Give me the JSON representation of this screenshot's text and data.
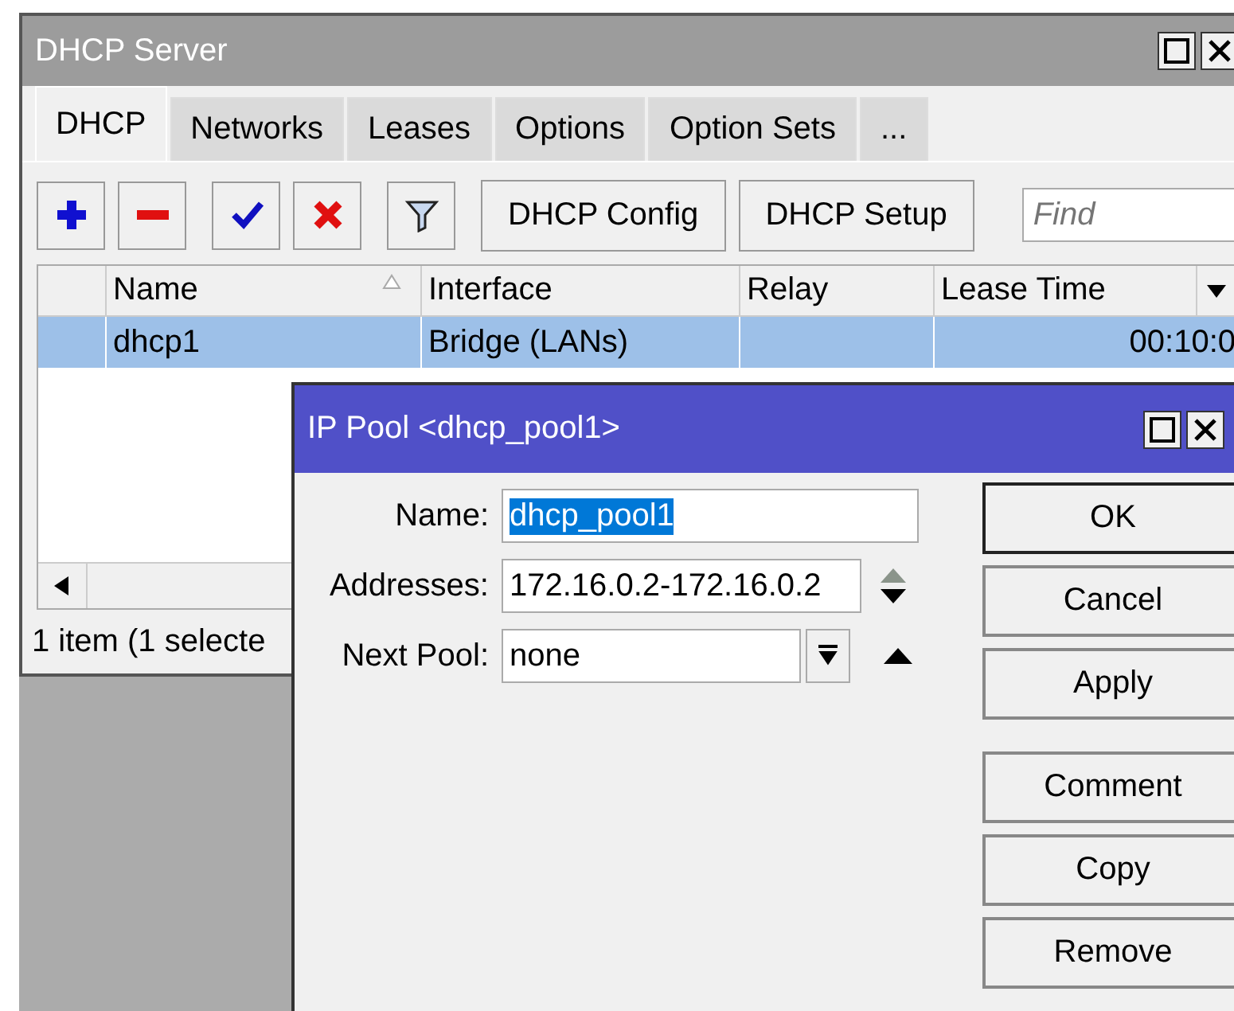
{
  "dhcp_window": {
    "title": "DHCP Server",
    "active": false,
    "tabs": [
      {
        "label": "DHCP",
        "selected": true
      },
      {
        "label": "Networks",
        "selected": false
      },
      {
        "label": "Leases",
        "selected": false
      },
      {
        "label": "Options",
        "selected": false
      },
      {
        "label": "Option Sets",
        "selected": false
      },
      {
        "label": "...",
        "selected": false
      }
    ],
    "toolbar_buttons": [
      "DHCP Config",
      "DHCP Setup"
    ],
    "find_placeholder": "Find",
    "table": {
      "columns": [
        "Name",
        "Interface",
        "Relay",
        "Lease Time"
      ],
      "rows": [
        {
          "name": "dhcp1",
          "interface": "Bridge (LANs)",
          "lease_time": "00:10:0",
          "selected": true
        }
      ]
    },
    "status": "1 item (1 selecte"
  },
  "dialog": {
    "title": "IP Pool <dhcp_pool1>",
    "active": true,
    "fields": [
      {
        "kind": "text",
        "label": "Name:",
        "value": "dhcp_pool1",
        "text_selected": true
      },
      {
        "kind": "spin",
        "label": "Addresses:",
        "value": "172.16.0.2-172.16.0.2",
        "text_selected": false
      },
      {
        "kind": "dropdown",
        "label": "Next Pool:",
        "value": "none",
        "text_selected": false
      }
    ],
    "buttons": [
      {
        "label": "OK",
        "default": true
      },
      {
        "label": "Cancel",
        "default": false
      },
      {
        "label": "Apply",
        "default": false
      },
      {
        "label": "Comment",
        "default": false
      },
      {
        "label": "Copy",
        "default": false
      },
      {
        "label": "Remove",
        "default": false
      }
    ]
  }
}
